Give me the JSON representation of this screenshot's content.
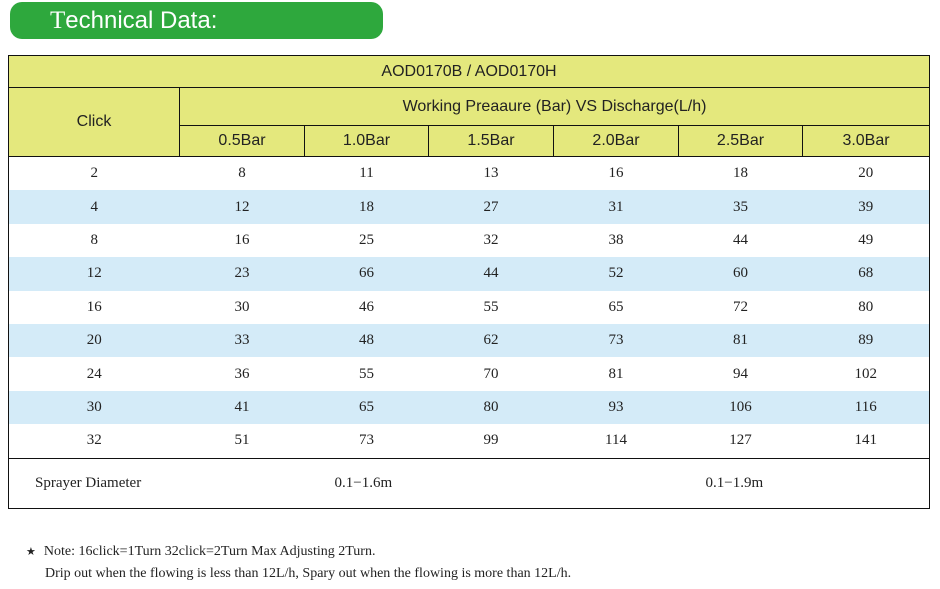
{
  "title": {
    "first_letter": "T",
    "rest": "echnical Data",
    "colon": ":"
  },
  "table": {
    "model": "AOD0170B / AOD0170H",
    "row_header": "Click",
    "group_header": "Working Preaaure (Bar) VS Discharge(L/h)",
    "columns": [
      "0.5Bar",
      "1.0Bar",
      "1.5Bar",
      "2.0Bar",
      "2.5Bar",
      "3.0Bar"
    ],
    "rows": [
      {
        "click": "2",
        "values": [
          "8",
          "11",
          "13",
          "16",
          "18",
          "20"
        ]
      },
      {
        "click": "4",
        "values": [
          "12",
          "18",
          "27",
          "31",
          "35",
          "39"
        ]
      },
      {
        "click": "8",
        "values": [
          "16",
          "25",
          "32",
          "38",
          "44",
          "49"
        ]
      },
      {
        "click": "12",
        "values": [
          "23",
          "66",
          "44",
          "52",
          "60",
          "68"
        ]
      },
      {
        "click": "16",
        "values": [
          "30",
          "46",
          "55",
          "65",
          "72",
          "80"
        ]
      },
      {
        "click": "20",
        "values": [
          "33",
          "48",
          "62",
          "73",
          "81",
          "89"
        ]
      },
      {
        "click": "24",
        "values": [
          "36",
          "55",
          "70",
          "81",
          "94",
          "102"
        ]
      },
      {
        "click": "30",
        "values": [
          "41",
          "65",
          "80",
          "93",
          "106",
          "116"
        ]
      },
      {
        "click": "32",
        "values": [
          "51",
          "73",
          "99",
          "114",
          "127",
          "141"
        ]
      }
    ],
    "sprayer": {
      "label": "Sprayer Diameter",
      "range_low": "0.1−1.6m",
      "range_high": "0.1−1.9m"
    }
  },
  "notes": {
    "star_icon": "★",
    "line1": "Note:  16click=1Turn 32click=2Turn  Max Adjusting 2Turn.",
    "line2": "Drip out when the flowing is less than 12L/h, Spary out when the flowing is more than 12L/h."
  },
  "colors": {
    "title_bg": "#2ea83d",
    "header_bg": "#e4e87d",
    "alt_row_bg": "#d4ebf8"
  }
}
